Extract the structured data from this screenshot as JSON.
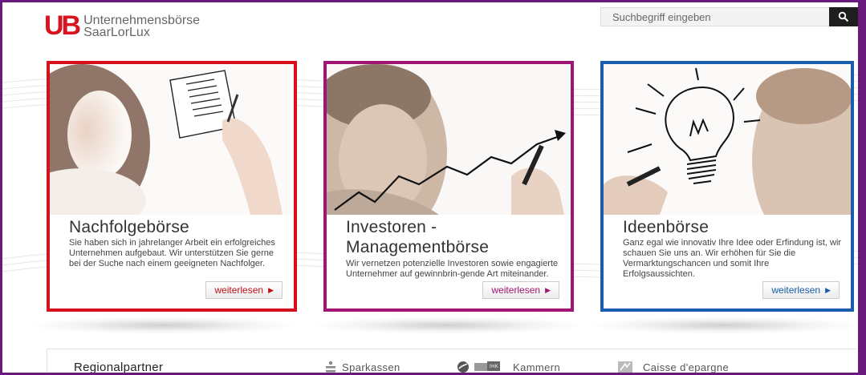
{
  "header": {
    "logo_mark": "UB",
    "logo_line1": "Unternehmensbörse",
    "logo_line2": "SaarLorLux",
    "search_placeholder": "Suchbegriff eingeben"
  },
  "cards": [
    {
      "title": "Nachfolgebörse",
      "text": "Sie haben sich in jahrelanger Arbeit ein erfolgreiches Unternehmen aufgebaut. Wir unterstützen Sie gerne bei der Suche nach einem geeigneten Nachfolger.",
      "button": "weiterlesen",
      "color": "#d6101c"
    },
    {
      "title_line1": "Investoren -",
      "title_line2": "Managementbörse",
      "text": "Wir vernetzen potenzielle Investoren sowie engagierte Unternehmer auf gewinnbrin-gende Art miteinander.",
      "button": "weiterlesen",
      "color": "#a31574"
    },
    {
      "title": "Ideenbörse",
      "text": "Ganz egal wie innovativ Ihre Idee oder Erfindung ist, wir schauen Sie uns an. Wir erhöhen für Sie die Vermarktungschancen und somit Ihre Erfolgsaussichten.",
      "button": "weiterlesen",
      "color": "#1a5dab"
    }
  ],
  "partners": {
    "title": "Regionalpartner",
    "items": [
      {
        "label": "Sparkassen",
        "icon": "sparkasse-icon"
      },
      {
        "label": "Kammern",
        "icon": "ihk-icon",
        "badge": "IHK"
      },
      {
        "label": "Caisse d'epargne",
        "icon": "caisse-icon"
      }
    ]
  }
}
